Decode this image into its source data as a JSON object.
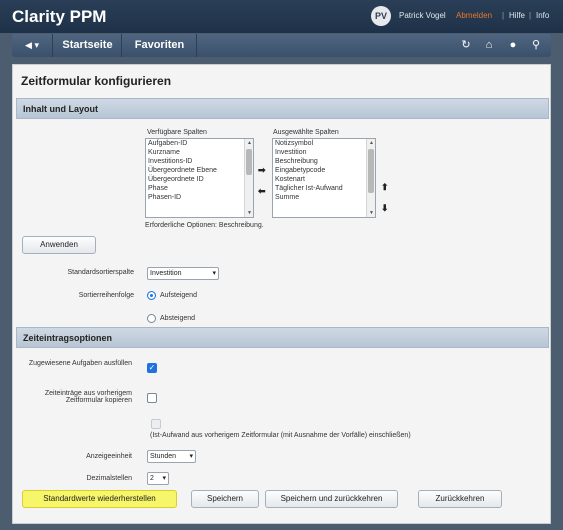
{
  "app": {
    "title": "Clarity PPM",
    "avatar_initials": "PV",
    "user_name": "Patrick Vogel",
    "logout": "Abmelden",
    "separator": "|",
    "help": "Hilfe",
    "info": "Info"
  },
  "nav": {
    "arrows": "◀ ▾",
    "tabs": [
      "Startseite",
      "Favoriten"
    ],
    "icons": [
      "refresh-icon",
      "home-icon",
      "settings-icon",
      "search-icon"
    ],
    "icon_glyphs": [
      "↻",
      "⌂",
      "●",
      "⚲"
    ]
  },
  "page": {
    "title": "Zeitformular konfigurieren"
  },
  "layout_section": {
    "header": "Inhalt und Layout",
    "available_label": "Verfügbare Spalten",
    "selected_label": "Ausgewählte Spalten",
    "available_columns": [
      "Aufgaben-ID",
      "Kurzname",
      "Investitions-ID",
      "Übergeordnete Ebene",
      "Übergeordnete ID",
      "Phase",
      "Phasen-ID"
    ],
    "selected_columns": [
      "Notizsymbol",
      "Investition",
      "Beschreibung",
      "Eingabetypcode",
      "Kostenart",
      "Täglicher Ist-Aufwand",
      "Summe"
    ],
    "move_right": "➡",
    "move_left": "⬅",
    "move_up": "⬆",
    "move_down": "⬇",
    "required_note": "Erforderliche Optionen: Beschreibung.",
    "apply_button": "Anwenden",
    "sort_column_label": "Standardsortierspalte",
    "sort_column_value": "Investition",
    "sort_order_label": "Sortierreihenfolge",
    "sort_ascending": "Aufsteigend",
    "sort_descending": "Absteigend",
    "sort_ascending_checked": true
  },
  "time_entry_section": {
    "header": "Zeiteintragsoptionen",
    "populate_assigned_label": "Zugewiesene Aufgaben ausfüllen",
    "populate_assigned_checked": true,
    "copy_previous_label": "Zeiteinträge aus vorherigem Zeitformular kopieren",
    "copy_previous_checked": false,
    "include_actuals_label": "(Ist-Aufwand aus vorherigem Zeitformular (mit Ausnahme der Vorfälle) einschließen)",
    "display_unit_label": "Anzeigeeinheit",
    "display_unit_value": "Stunden",
    "decimals_label": "Dezimalstellen",
    "decimals_value": "2"
  },
  "actions": {
    "restore_defaults": "Standardwerte wiederherstellen",
    "save": "Speichern",
    "save_and_return": "Speichern und zurückkehren",
    "return": "Zurückkehren"
  },
  "colors": {
    "topbar": "#1e3148",
    "navbar": "#506681",
    "section_bar": "#c7d3df",
    "highlight": "#f7f56a",
    "accent": "#1f73e0",
    "logout": "#e8792c"
  }
}
